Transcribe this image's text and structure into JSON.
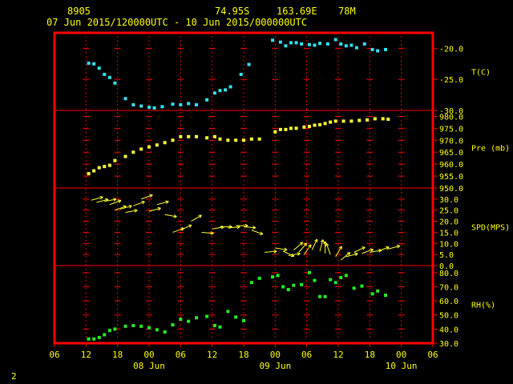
{
  "header": {
    "station_id": "8905",
    "latitude": "74.95S",
    "longitude": "163.69E",
    "elevation": "78M",
    "time_range": "07 Jun 2015/120000UTC - 10 Jun 2015/000000UTC"
  },
  "footer": {
    "page_number": "2"
  },
  "colors": {
    "background": "#000000",
    "frame": "#ff0000",
    "labels": "#ffff00",
    "temperature": "#33e0f0",
    "pressure": "#ffff33",
    "wind": "#ffff33",
    "humidity": "#22ee22"
  },
  "chart_data": {
    "type": "scatter",
    "x_axis": {
      "unit": "hours since 07 Jun 2015 12:00 UTC",
      "range": [
        -6,
        66
      ],
      "ticks": [
        {
          "x": -6,
          "label": "06"
        },
        {
          "x": 0,
          "label": "12"
        },
        {
          "x": 6,
          "label": "18"
        },
        {
          "x": 12,
          "label": "00"
        },
        {
          "x": 18,
          "label": "06"
        },
        {
          "x": 24,
          "label": "12"
        },
        {
          "x": 30,
          "label": "18"
        },
        {
          "x": 36,
          "label": "00"
        },
        {
          "x": 42,
          "label": "06"
        },
        {
          "x": 48,
          "label": "12"
        },
        {
          "x": 54,
          "label": "18"
        },
        {
          "x": 60,
          "label": "00"
        },
        {
          "x": 66,
          "label": "06"
        }
      ],
      "day_labels": [
        {
          "x": 12,
          "label": "08 Jun"
        },
        {
          "x": 36,
          "label": "09 Jun"
        },
        {
          "x": 60,
          "label": "10 Jun"
        }
      ]
    },
    "panels": [
      {
        "key": "temperature",
        "label": "T(C)",
        "ylim": [
          -30,
          -17.5
        ],
        "ticks": [
          -20,
          -25,
          -30
        ],
        "tick_labels": [
          "-20.0",
          "-25.0",
          "-30.0"
        ],
        "points": [
          [
            0.5,
            -22.4
          ],
          [
            1.5,
            -22.5
          ],
          [
            2.5,
            -23.2
          ],
          [
            3.5,
            -24.2
          ],
          [
            4.5,
            -24.7
          ],
          [
            5.5,
            -25.6
          ],
          [
            7.5,
            -28.1
          ],
          [
            9.0,
            -29.1
          ],
          [
            10.5,
            -29.3
          ],
          [
            12.0,
            -29.5
          ],
          [
            13.0,
            -29.6
          ],
          [
            14.5,
            -29.4
          ],
          [
            16.5,
            -29.0
          ],
          [
            18.0,
            -29.1
          ],
          [
            19.5,
            -28.9
          ],
          [
            21.0,
            -29.1
          ],
          [
            23.0,
            -28.3
          ],
          [
            24.5,
            -27.2
          ],
          [
            25.5,
            -26.8
          ],
          [
            26.5,
            -26.7
          ],
          [
            27.5,
            -26.2
          ],
          [
            29.5,
            -24.2
          ],
          [
            31.0,
            -22.6
          ],
          [
            35.5,
            -18.7
          ],
          [
            37.0,
            -19.0
          ],
          [
            38.0,
            -19.6
          ],
          [
            39.0,
            -19.1
          ],
          [
            40.0,
            -19.1
          ],
          [
            41.0,
            -19.3
          ],
          [
            42.5,
            -19.4
          ],
          [
            43.5,
            -19.5
          ],
          [
            44.5,
            -19.2
          ],
          [
            46.0,
            -19.3
          ],
          [
            47.5,
            -18.6
          ],
          [
            48.5,
            -19.3
          ],
          [
            49.5,
            -19.6
          ],
          [
            50.5,
            -19.5
          ],
          [
            51.5,
            -19.9
          ],
          [
            53.0,
            -19.3
          ],
          [
            54.5,
            -20.2
          ],
          [
            55.5,
            -20.4
          ],
          [
            57.0,
            -20.2
          ]
        ]
      },
      {
        "key": "pressure",
        "label": "Pre (mb)",
        "ylim": [
          950,
          982.5
        ],
        "ticks": [
          980,
          975,
          970,
          965,
          960,
          955,
          950
        ],
        "tick_labels": [
          "980.0",
          "975.0",
          "970.0",
          "965.0",
          "960.0",
          "955.0",
          "950.0"
        ],
        "points": [
          [
            0.5,
            956.0
          ],
          [
            1.5,
            957.2
          ],
          [
            2.5,
            958.5
          ],
          [
            3.5,
            959.0
          ],
          [
            4.5,
            959.5
          ],
          [
            5.5,
            961.5
          ],
          [
            7.5,
            963.2
          ],
          [
            9.0,
            965.0
          ],
          [
            10.5,
            966.3
          ],
          [
            12.0,
            967.2
          ],
          [
            13.5,
            968.0
          ],
          [
            15.0,
            969.0
          ],
          [
            16.5,
            970.0
          ],
          [
            18.0,
            971.5
          ],
          [
            19.5,
            971.5
          ],
          [
            21.0,
            971.5
          ],
          [
            23.0,
            971.0
          ],
          [
            24.5,
            971.5
          ],
          [
            25.5,
            970.5
          ],
          [
            27.0,
            970.0
          ],
          [
            28.5,
            970.0
          ],
          [
            30.0,
            970.0
          ],
          [
            31.5,
            970.5
          ],
          [
            33.0,
            970.5
          ],
          [
            36.0,
            973.5
          ],
          [
            37.0,
            974.5
          ],
          [
            38.0,
            974.5
          ],
          [
            39.0,
            975.0
          ],
          [
            40.0,
            975.0
          ],
          [
            41.5,
            975.5
          ],
          [
            42.5,
            975.8
          ],
          [
            43.5,
            976.3
          ],
          [
            44.5,
            976.5
          ],
          [
            45.5,
            977.0
          ],
          [
            46.5,
            977.6
          ],
          [
            47.5,
            978.0
          ],
          [
            49.0,
            978.0
          ],
          [
            50.5,
            978.0
          ],
          [
            52.0,
            978.3
          ],
          [
            53.5,
            978.5
          ],
          [
            55.0,
            979.0
          ],
          [
            56.5,
            979.0
          ],
          [
            57.5,
            978.8
          ]
        ]
      },
      {
        "key": "wind",
        "label": "SPD(MPS)",
        "ylim": [
          0,
          35
        ],
        "ticks": [
          30,
          25,
          20,
          15,
          10,
          5,
          0
        ],
        "tick_labels": [
          "30.0",
          "25.0",
          "20.0",
          "15.0",
          "10.0",
          "5.0",
          "0.0"
        ],
        "arrows": [
          [
            1.0,
            29.5,
            15
          ],
          [
            2.0,
            28.5,
            15
          ],
          [
            3.5,
            29.0,
            10
          ],
          [
            4.5,
            27.5,
            20
          ],
          [
            5.5,
            25.0,
            20
          ],
          [
            6.5,
            25.5,
            15
          ],
          [
            7.5,
            24.0,
            10
          ],
          [
            9.0,
            27.0,
            20
          ],
          [
            10.5,
            30.0,
            20
          ],
          [
            12.0,
            24.5,
            15
          ],
          [
            13.5,
            27.5,
            15
          ],
          [
            15.0,
            23.0,
            -10
          ],
          [
            16.5,
            15.0,
            20
          ],
          [
            18.0,
            16.0,
            25
          ],
          [
            20.0,
            20.0,
            30
          ],
          [
            22.0,
            15.0,
            -5
          ],
          [
            24.0,
            16.5,
            10
          ],
          [
            25.5,
            17.5,
            0
          ],
          [
            27.0,
            17.0,
            5
          ],
          [
            28.5,
            18.0,
            0
          ],
          [
            30.0,
            17.5,
            -5
          ],
          [
            31.5,
            16.0,
            -20
          ],
          [
            34.0,
            6.0,
            5
          ],
          [
            36.0,
            8.0,
            -10
          ],
          [
            37.5,
            6.5,
            -25
          ],
          [
            38.5,
            4.5,
            10
          ],
          [
            39.5,
            7.0,
            40
          ],
          [
            40.5,
            6.0,
            50
          ],
          [
            41.5,
            5.0,
            55
          ],
          [
            43.0,
            7.0,
            65
          ],
          [
            44.5,
            6.5,
            75
          ],
          [
            45.5,
            5.5,
            90
          ],
          [
            46.5,
            5.0,
            110
          ],
          [
            47.5,
            4.0,
            60
          ],
          [
            48.5,
            2.5,
            40
          ],
          [
            49.5,
            4.0,
            15
          ],
          [
            51.0,
            6.0,
            25
          ],
          [
            52.5,
            5.5,
            20
          ],
          [
            54.0,
            6.0,
            10
          ],
          [
            55.5,
            6.5,
            20
          ],
          [
            57.5,
            7.5,
            15
          ]
        ]
      },
      {
        "key": "humidity",
        "label": "RH(%)",
        "ylim": [
          30,
          85
        ],
        "ticks": [
          80,
          70,
          60,
          50,
          40,
          30
        ],
        "tick_labels": [
          "80.0",
          "70.0",
          "60.0",
          "50.0",
          "40.0",
          "30.0"
        ],
        "points": [
          [
            0.5,
            33.0
          ],
          [
            1.5,
            33.0
          ],
          [
            2.5,
            34.0
          ],
          [
            3.5,
            36.0
          ],
          [
            4.5,
            39.0
          ],
          [
            5.5,
            40.0
          ],
          [
            7.5,
            42.0
          ],
          [
            9.0,
            42.5
          ],
          [
            10.5,
            42.0
          ],
          [
            12.0,
            41.0
          ],
          [
            13.5,
            39.5
          ],
          [
            15.0,
            38.0
          ],
          [
            16.5,
            43.0
          ],
          [
            18.0,
            47.0
          ],
          [
            19.5,
            45.5
          ],
          [
            21.0,
            48.0
          ],
          [
            23.0,
            49.0
          ],
          [
            24.5,
            42.5
          ],
          [
            25.5,
            41.5
          ],
          [
            27.0,
            52.5
          ],
          [
            28.5,
            48.5
          ],
          [
            30.0,
            46.0
          ],
          [
            31.5,
            73.0
          ],
          [
            33.0,
            76.0
          ],
          [
            35.5,
            77.0
          ],
          [
            36.5,
            78.0
          ],
          [
            37.5,
            70.0
          ],
          [
            38.5,
            68.0
          ],
          [
            39.5,
            71.0
          ],
          [
            41.0,
            71.5
          ],
          [
            42.5,
            80.0
          ],
          [
            43.5,
            74.5
          ],
          [
            44.5,
            63.0
          ],
          [
            45.5,
            63.0
          ],
          [
            46.5,
            75.0
          ],
          [
            47.5,
            73.0
          ],
          [
            48.5,
            76.5
          ],
          [
            49.5,
            78.0
          ],
          [
            51.0,
            69.0
          ],
          [
            52.5,
            70.5
          ],
          [
            54.5,
            65.0
          ],
          [
            55.5,
            67.0
          ],
          [
            57.0,
            64.0
          ]
        ]
      }
    ]
  }
}
